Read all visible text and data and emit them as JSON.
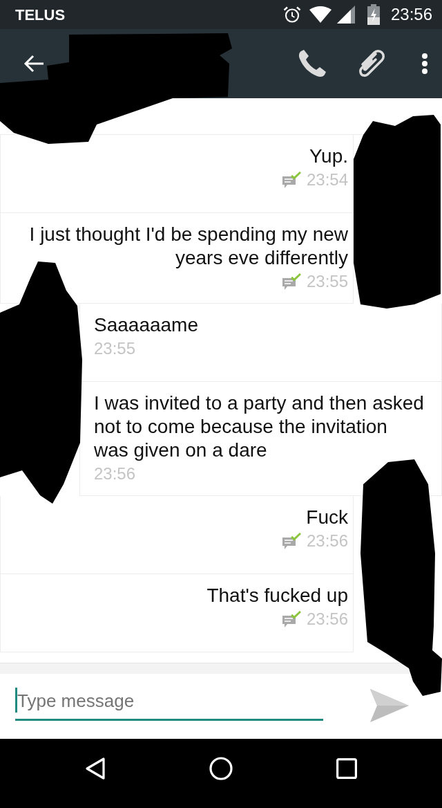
{
  "status_bar": {
    "carrier": "TELUS",
    "time": "23:56"
  },
  "messages": [
    {
      "kind": "outgoing",
      "text": "Yup.",
      "time": "23:54",
      "delivered": true
    },
    {
      "kind": "outgoing",
      "text": "I just thought I'd be spending my new years eve differently",
      "time": "23:55",
      "delivered": true
    },
    {
      "kind": "incoming",
      "text": "Saaaaaame",
      "time": "23:55",
      "delivered": false
    },
    {
      "kind": "incoming",
      "text": "I was invited to a party and then asked not to come because the invitation was given on a dare",
      "time": "23:56",
      "delivered": false
    },
    {
      "kind": "outgoing",
      "text": "Fuck",
      "time": "23:56",
      "delivered": true
    },
    {
      "kind": "outgoing",
      "text": "That's fucked up",
      "time": "23:56",
      "delivered": true
    }
  ],
  "composer": {
    "placeholder": "Type message",
    "focused": true
  }
}
